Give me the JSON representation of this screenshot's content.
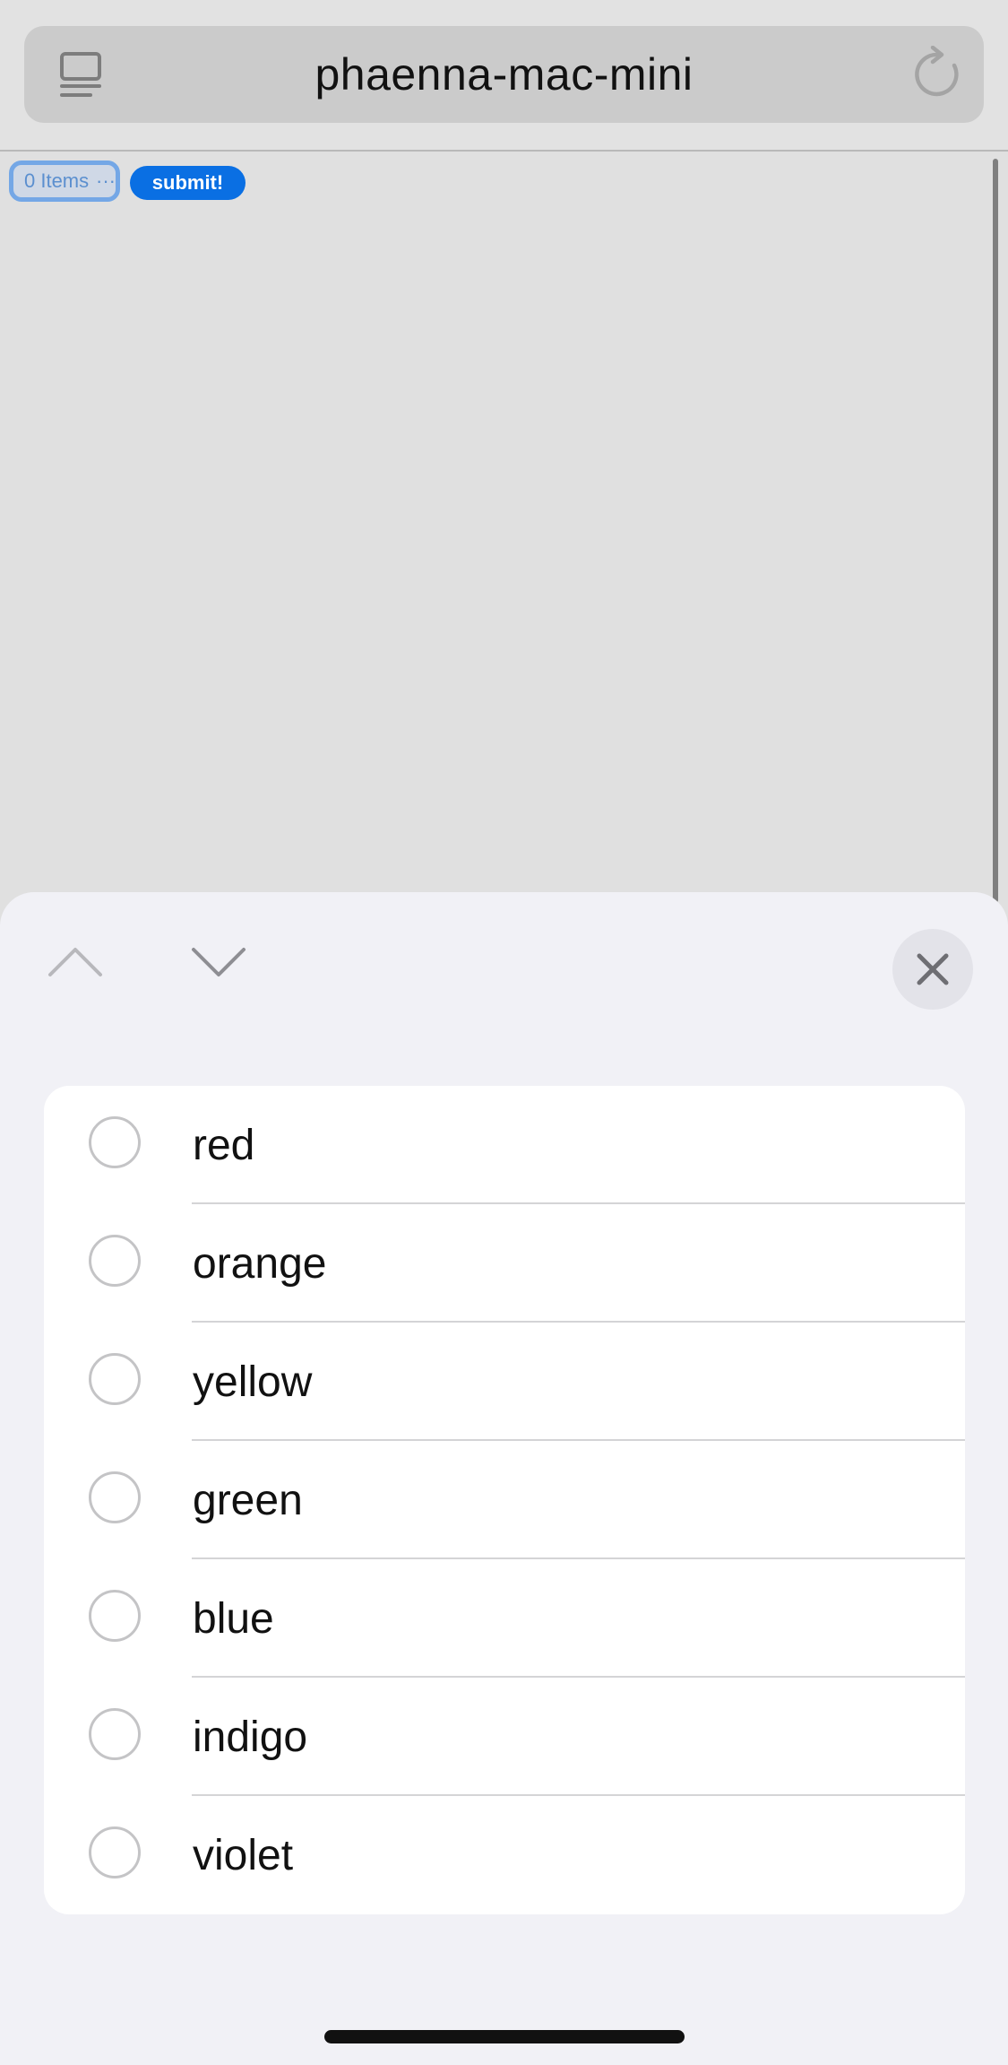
{
  "browser": {
    "url_title": "phaenna-mac-mini",
    "device_icon": "device-list-icon",
    "reload_icon": "reload-icon"
  },
  "page": {
    "select_label": "0 Items",
    "select_more": "···",
    "submit_label": "submit!"
  },
  "picker": {
    "prev_icon": "chevron-up-icon",
    "next_icon": "chevron-down-icon",
    "close_icon": "close-icon",
    "options": [
      {
        "label": "red",
        "selected": false
      },
      {
        "label": "orange",
        "selected": false
      },
      {
        "label": "yellow",
        "selected": false
      },
      {
        "label": "green",
        "selected": false
      },
      {
        "label": "blue",
        "selected": false
      },
      {
        "label": "indigo",
        "selected": false
      },
      {
        "label": "violet",
        "selected": false
      }
    ]
  },
  "colors": {
    "accent": "#0a6fe3",
    "sheet_bg": "#f1f1f6",
    "page_bg": "#e0e0e0"
  }
}
